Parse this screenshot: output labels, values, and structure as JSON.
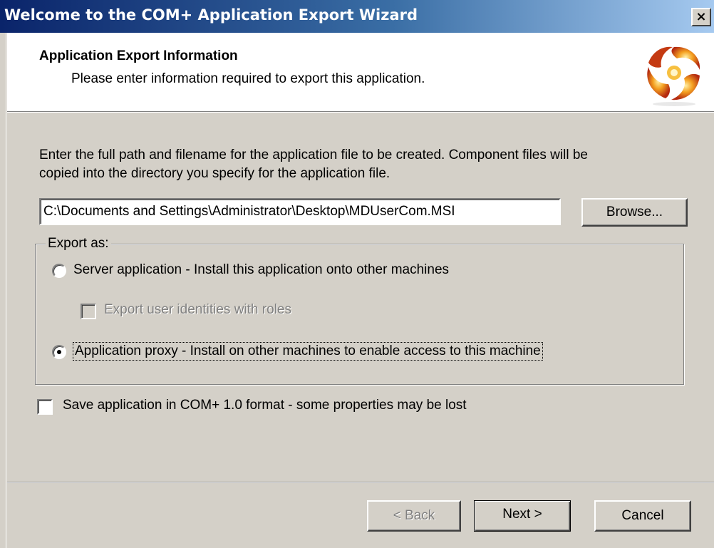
{
  "window": {
    "title": "Welcome to the COM+ Application Export Wizard",
    "close_glyph": "×"
  },
  "header": {
    "title": "Application Export Information",
    "subtitle": "Please enter information required to export this application.",
    "logo_icon": "com-plus-swirl-icon"
  },
  "body": {
    "instructions_line1": "Enter the full path and filename for the application file to be created.  Component files will be",
    "instructions_line2": "copied into the directory you specify for the application file.",
    "path_value": "C:\\Documents and Settings\\Administrator\\Desktop\\MDUserCom.MSI",
    "browse_label": "Browse..."
  },
  "export_as": {
    "group_label": "Export as:",
    "server_option": {
      "label": "Server application - Install this application onto other machines",
      "selected": false
    },
    "export_identities": {
      "label": "Export user identities with roles",
      "checked": false,
      "enabled": false
    },
    "proxy_option": {
      "label": "Application proxy - Install on other machines to enable access to this machine",
      "selected": true
    }
  },
  "com10_format": {
    "label": "Save application in COM+ 1.0 format - some properties may be lost",
    "checked": false
  },
  "footer": {
    "back_label": "< Back",
    "next_label": "Next >",
    "cancel_label": "Cancel"
  },
  "colors": {
    "titlebar_start": "#0a246a",
    "titlebar_end": "#a6caf0",
    "face": "#d4d0c8",
    "header_bg": "#ffffff",
    "disabled_text": "#808080"
  }
}
